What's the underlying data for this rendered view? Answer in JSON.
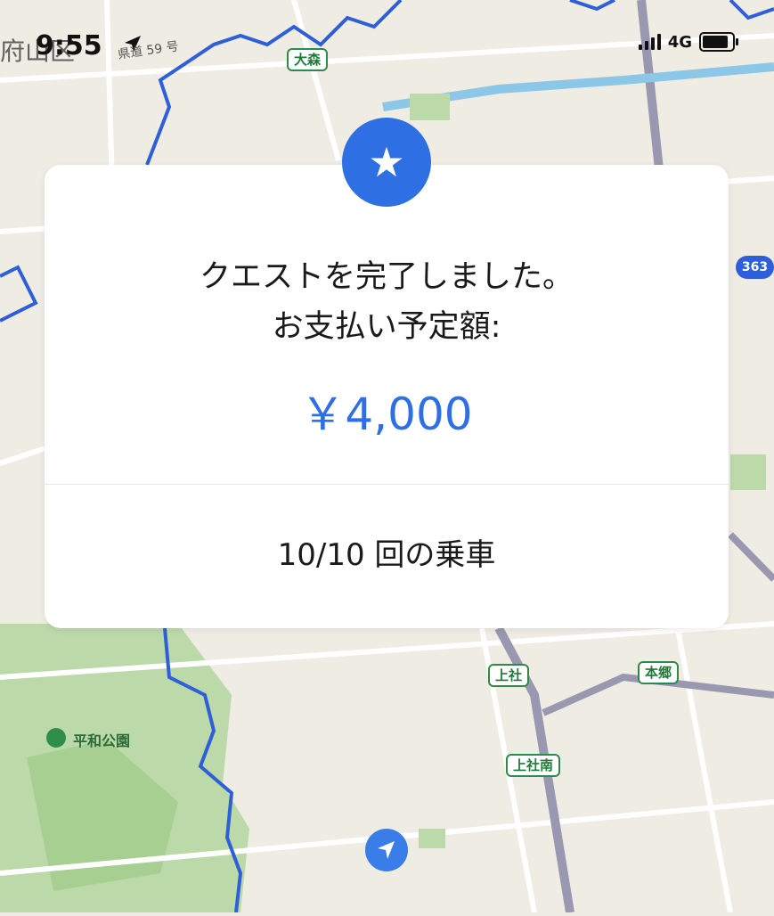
{
  "status_bar": {
    "time": "9:55",
    "overlay_text": "府山区",
    "network": "4G"
  },
  "map": {
    "route_label": "県道 59 号",
    "stations": [
      {
        "label": "大森"
      },
      {
        "label": "上社"
      },
      {
        "label": "本郷"
      },
      {
        "label": "上社南"
      }
    ],
    "route_shield": "363",
    "park_label": "平和公園"
  },
  "card": {
    "line1": "クエストを完了しました。",
    "line2": "お支払い予定額:",
    "amount": "￥4,000",
    "rides": "10/10 回の乗車"
  },
  "colors": {
    "accent_blue": "#2f6fe4",
    "map_bg": "#efece4",
    "route_blue": "#2f5fd8",
    "park_green": "#b8d8a4",
    "label_green": "#2e8b47"
  },
  "icons": {
    "star": "star-icon",
    "location_arrow": "location-arrow-icon",
    "navigation": "navigation-icon",
    "park": "tree-icon"
  }
}
